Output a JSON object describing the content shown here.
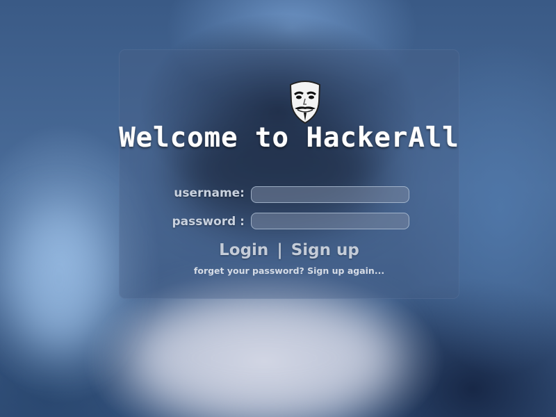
{
  "page": {
    "title": "Welcome to HackerAll",
    "logo_icon": "guy-fawkes-mask-icon"
  },
  "login_form": {
    "username_label": "username:",
    "password_label": "password :",
    "username_value": "",
    "password_value": "",
    "login_link": "Login",
    "separator": "|",
    "signup_link": "Sign up",
    "forgot_text": "forget your password? Sign up again..."
  },
  "colors": {
    "background": "#3a5a86",
    "panel": "rgba(70,95,135,0.38)",
    "title_text": "#ffffff",
    "label_text": "#c9d2df",
    "input_fill": "#7a879f"
  }
}
